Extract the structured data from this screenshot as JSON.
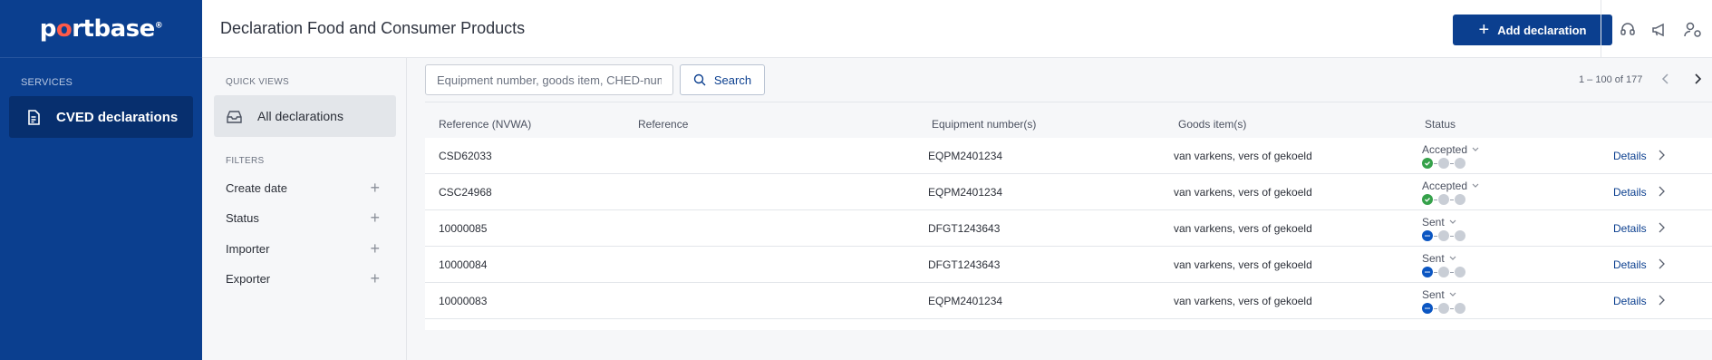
{
  "brand": {
    "logo_text_1": "p",
    "logo_text_accent": "o",
    "logo_text_2": "rtbase",
    "logo_mark": "®"
  },
  "nav": {
    "section_label": "SERVICES",
    "items": [
      {
        "label": "CVED declarations",
        "icon": "document-icon",
        "active": true
      }
    ]
  },
  "header": {
    "title": "Declaration Food and Consumer Products",
    "add_button_label": "Add declaration",
    "icons": [
      "headset-icon",
      "megaphone-icon",
      "user-settings-icon"
    ]
  },
  "filters": {
    "quick_views_label": "QUICK VIEWS",
    "quick_views": [
      {
        "label": "All declarations",
        "icon": "inbox-icon",
        "active": true
      }
    ],
    "filters_label": "FILTERS",
    "items": [
      {
        "label": "Create date"
      },
      {
        "label": "Status"
      },
      {
        "label": "Importer"
      },
      {
        "label": "Exporter"
      }
    ]
  },
  "search": {
    "placeholder": "Equipment number, goods item, CHED-number",
    "button_label": "Search"
  },
  "pagination": {
    "range": "1 – 100 of 177"
  },
  "table": {
    "columns": [
      "Reference (NVWA)",
      "Reference",
      "Equipment number(s)",
      "Goods item(s)",
      "Status"
    ],
    "details_label": "Details",
    "rows": [
      {
        "ref_nvwa": "CSD62033",
        "reference": "",
        "equipment": "EQPM2401234",
        "goods": "van varkens, vers of gekoeld",
        "status": "Accepted",
        "state": "ok"
      },
      {
        "ref_nvwa": "CSC24968",
        "reference": "",
        "equipment": "EQPM2401234",
        "goods": "van varkens, vers of gekoeld",
        "status": "Accepted",
        "state": "ok"
      },
      {
        "ref_nvwa": "10000085",
        "reference": "",
        "equipment": "DFGT1243643",
        "goods": "van varkens, vers of gekoeld",
        "status": "Sent",
        "state": "sent"
      },
      {
        "ref_nvwa": "10000084",
        "reference": "",
        "equipment": "DFGT1243643",
        "goods": "van varkens, vers of gekoeld",
        "status": "Sent",
        "state": "sent"
      },
      {
        "ref_nvwa": "10000083",
        "reference": "",
        "equipment": "EQPM2401234",
        "goods": "van varkens, vers of gekoeld",
        "status": "Sent",
        "state": "sent"
      }
    ]
  },
  "colors": {
    "brand": "#0b3f8f",
    "accent": "#ff5a49",
    "accepted": "#35a14a",
    "sent": "#0b56c2"
  }
}
